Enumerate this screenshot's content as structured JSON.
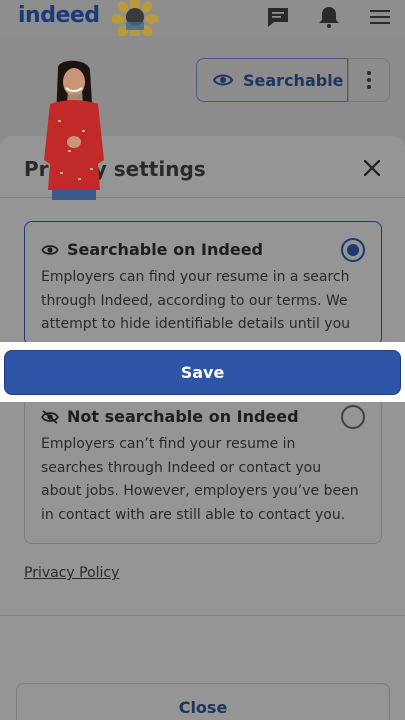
{
  "header": {
    "logo_text": "indeed",
    "icons": [
      "messages-icon",
      "notifications-icon",
      "menu-icon"
    ]
  },
  "profile": {
    "status_pill_label": "Searchable"
  },
  "modal": {
    "title": "Privacy settings",
    "options": [
      {
        "title": "Searchable on Indeed",
        "description": "Employers can find your resume in a search through Indeed, according to our terms. We attempt to hide identifiable details until you",
        "selected": true
      },
      {
        "title": "Not searchable on Indeed",
        "description": "Employers can’t find your resume in searches through Indeed or contact you about jobs. However, employers you’ve been in contact with are still able to contact you.",
        "selected": false
      }
    ],
    "privacy_link": "Privacy Policy",
    "save_label": "Save",
    "close_label": "Close"
  },
  "colors": {
    "primary": "#2e55a8",
    "brand": "#1f3a70"
  }
}
